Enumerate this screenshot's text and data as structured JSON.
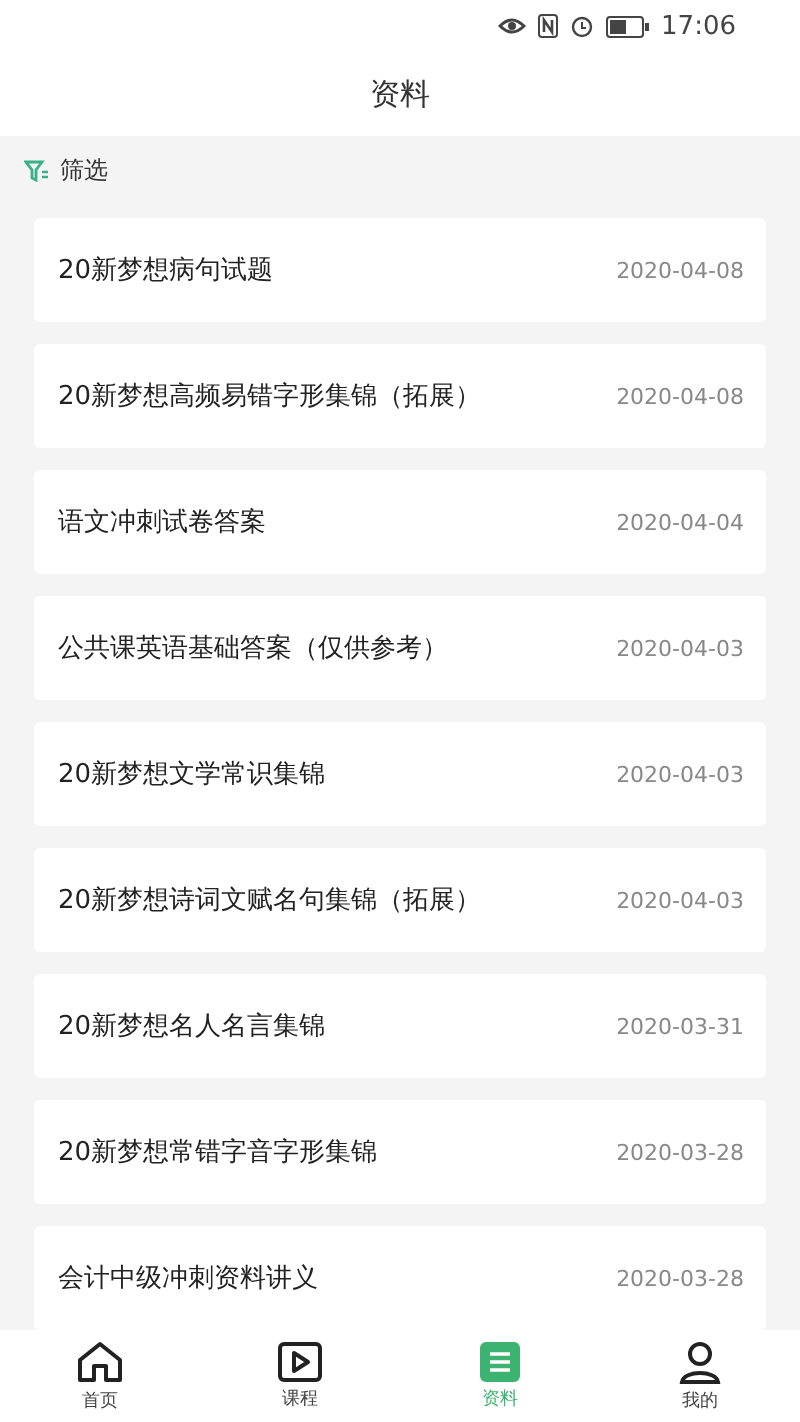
{
  "status_bar": {
    "time": "17:06"
  },
  "header": {
    "title": "资料"
  },
  "filter": {
    "label": "筛选"
  },
  "items": [
    {
      "title": "20新梦想病句试题",
      "date": "2020-04-08"
    },
    {
      "title": "20新梦想高频易错字形集锦（拓展）",
      "date": "2020-04-08"
    },
    {
      "title": "语文冲刺试卷答案",
      "date": "2020-04-04"
    },
    {
      "title": "公共课英语基础答案（仅供参考）",
      "date": "2020-04-03"
    },
    {
      "title": "20新梦想文学常识集锦",
      "date": "2020-04-03"
    },
    {
      "title": "20新梦想诗词文赋名句集锦（拓展）",
      "date": "2020-04-03"
    },
    {
      "title": "20新梦想名人名言集锦",
      "date": "2020-03-31"
    },
    {
      "title": "20新梦想常错字音字形集锦",
      "date": "2020-03-28"
    },
    {
      "title": "会计中级冲刺资料讲义",
      "date": "2020-03-28"
    }
  ],
  "tabs": [
    {
      "kind": "home",
      "label": "首页",
      "selected": false
    },
    {
      "kind": "course",
      "label": "课程",
      "selected": false
    },
    {
      "kind": "docs",
      "label": "资料",
      "selected": true
    },
    {
      "kind": "me",
      "label": "我的",
      "selected": false
    }
  ]
}
